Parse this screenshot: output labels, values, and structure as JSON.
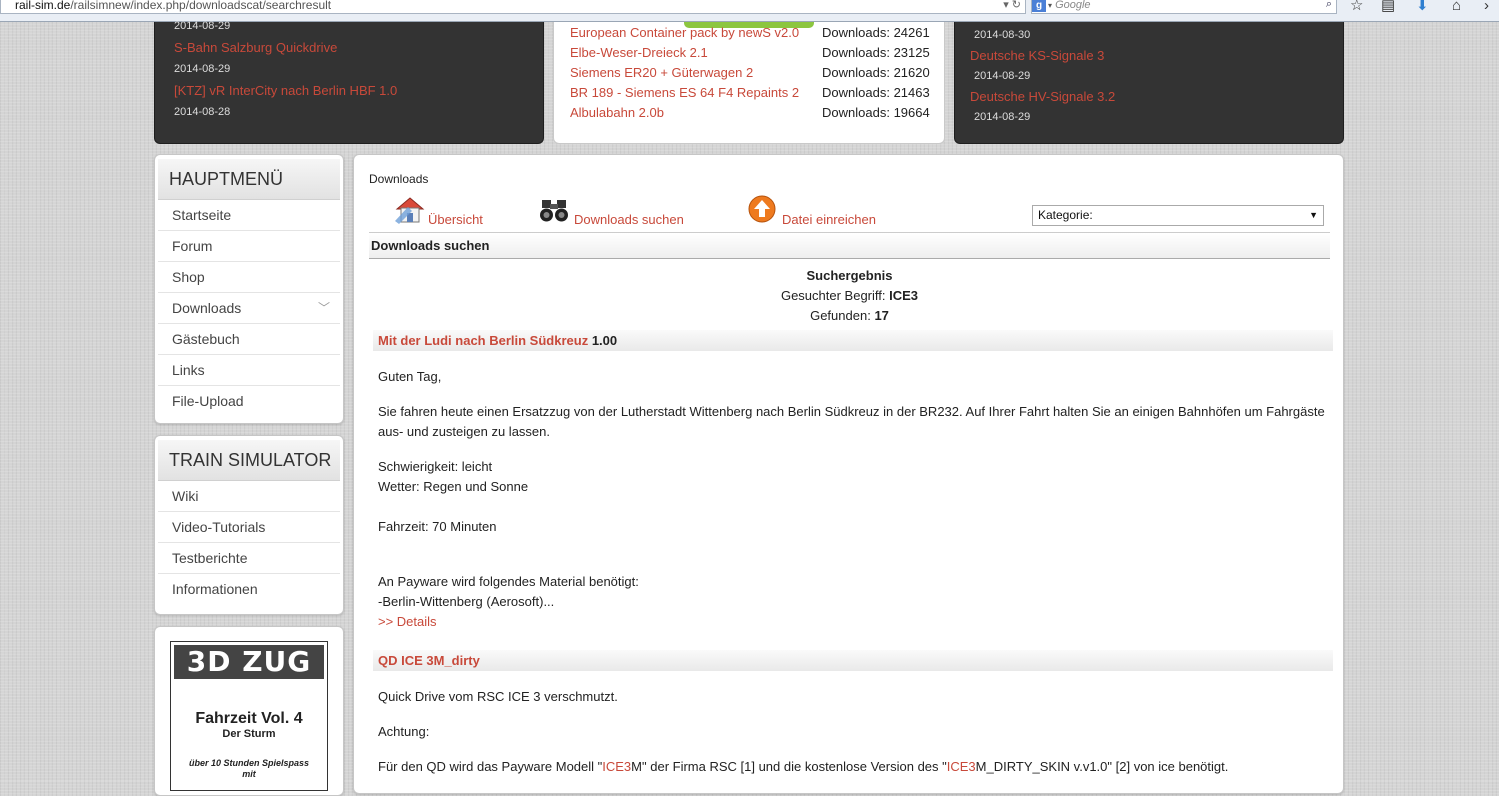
{
  "browser": {
    "url_domain": "rail-sim.de",
    "url_path": "/railsimnew/index.php/downloadscat/searchresult",
    "search_placeholder": "Google"
  },
  "top_left": {
    "items": [
      {
        "date": "2014-08-29"
      },
      {
        "title": "S-Bahn Salzburg Quickdrive",
        "date": "2014-08-29"
      },
      {
        "title": "[KTZ] vR InterCity nach Berlin HBF 1.0",
        "date": "2014-08-28"
      }
    ]
  },
  "top_mid": {
    "label_prefix": "Downloads:",
    "items": [
      {
        "title": "European Container pack by newS v2.0",
        "count": "24261"
      },
      {
        "title": "Elbe-Weser-Dreieck 2.1",
        "count": "23125"
      },
      {
        "title": "Siemens ER20 + Güterwagen 2",
        "count": "21620"
      },
      {
        "title": "BR 189 - Siemens ES 64 F4 Repaints 2",
        "count": "21463"
      },
      {
        "title": "Albulabahn 2.0b",
        "count": "19664"
      }
    ]
  },
  "top_right": {
    "items": [
      {
        "date": "2014-08-30"
      },
      {
        "title": "Deutsche KS-Signale 3",
        "date": "2014-08-29"
      },
      {
        "title": "Deutsche HV-Signale 3.2",
        "date": "2014-08-29"
      }
    ]
  },
  "sidebar": {
    "main_menu": {
      "title": "HAUPTMENÜ",
      "items": [
        "Startseite",
        "Forum",
        "Shop",
        "Downloads",
        "Gästebuch",
        "Links",
        "File-Upload"
      ]
    },
    "train_sim": {
      "title": "TRAIN SIMULATOR",
      "items": [
        "Wiki",
        "Video-Tutorials",
        "Testberichte",
        "Informationen"
      ]
    },
    "ad": {
      "logo": "3D ZUG",
      "title": "Fahrzeit Vol. 4",
      "subtitle": "Der Sturm",
      "tagline_1": "über 10 Stunden Spielspass",
      "tagline_2": "mit"
    }
  },
  "main": {
    "breadcrumb": "Downloads",
    "nav": {
      "overview": "Übersicht",
      "search": "Downloads suchen",
      "submit": "Datei einreichen"
    },
    "category_label": "Kategorie:",
    "section_title": "Downloads suchen",
    "result": {
      "heading": "Suchergebnis",
      "term_label": "Gesuchter Begriff:",
      "term": "ICE3",
      "found_label": "Gefunden:",
      "found": "17"
    },
    "entries": [
      {
        "title": "Mit der Ludi nach Berlin Südkreuz",
        "version": "1.00",
        "lines": [
          "Guten Tag,",
          "Sie fahren heute einen Ersatzzug von der Lutherstadt Wittenberg nach Berlin Südkreuz in der BR232. Auf Ihrer Fahrt halten Sie an einigen Bahnhöfen um Fahrgäste",
          "aus- und zusteigen zu lassen.",
          "Schwierigkeit: leicht",
          "Wetter: Regen und Sonne",
          "Fahrzeit: 70 Minuten",
          "An Payware wird folgendes Material benötigt:",
          "-Berlin-Wittenberg (Aerosoft)..."
        ],
        "details": ">> Details"
      },
      {
        "title": "QD ICE 3M_dirty",
        "lines": [
          "Quick Drive vom RSC ICE 3 verschmutzt.",
          "Achtung:"
        ],
        "last_line": {
          "p1": "Für den QD wird das Payware Modell \"",
          "hl1": "ICE3",
          "p2": "M\" der Firma RSC [1] und die kostenlose Version des \"",
          "hl2": "ICE3",
          "p3": "M_DIRTY_SKIN v.v1.0\" [2] von ice benötigt."
        }
      }
    ]
  }
}
